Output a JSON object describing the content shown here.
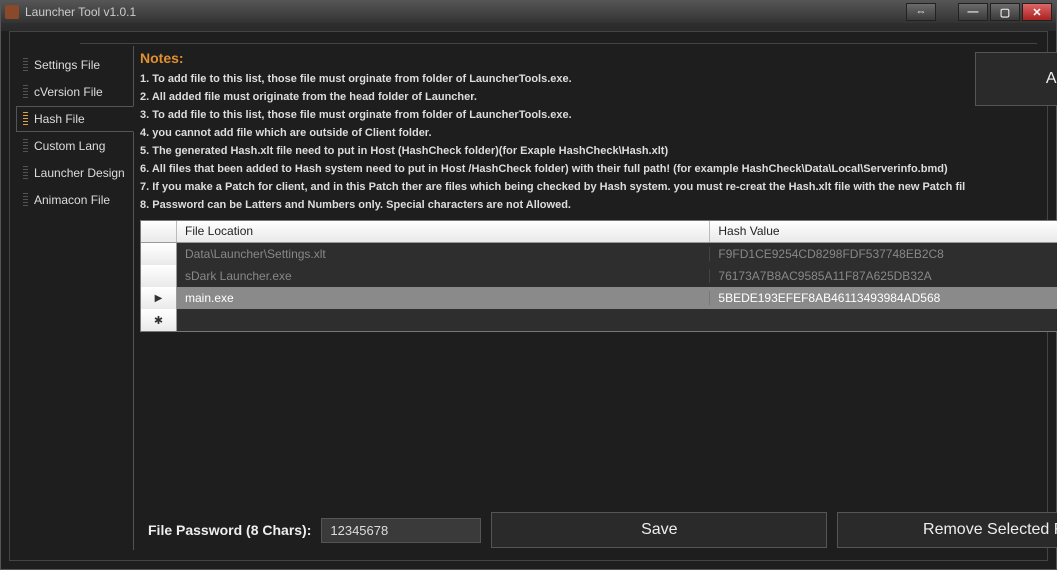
{
  "window": {
    "title": "Launcher Tool v1.0.1"
  },
  "sidebar": {
    "tabs": [
      {
        "label": "Settings File"
      },
      {
        "label": "cVersion File"
      },
      {
        "label": "Hash File"
      },
      {
        "label": "Custom Lang"
      },
      {
        "label": "Launcher Design"
      },
      {
        "label": "Animacon File"
      }
    ],
    "active_index": 2
  },
  "notes": {
    "title": "Notes:",
    "lines": [
      "1. To add file to this list, those file must orginate from folder of LauncherTools.exe.",
      "2. All added file must originate from the head folder of Launcher.",
      "3. To add file to this list, those file must orginate from folder of LauncherTools.exe.",
      "4. you cannot add file which are outside of Client folder.",
      "5. The generated Hash.xlt file need to put in Host (HashCheck folder)(for Exaple HashCheck\\Hash.xlt)",
      "6. All files that been added to Hash system need to put in Host /HashCheck folder) with their full path! (for example HashCheck\\Data\\Local\\Serverinfo.bmd)",
      "7. If you make a Patch for client, and in this Patch ther are files which being checked by Hash system. you must re-creat the Hash.xlt file with the new Patch fil",
      "8. Password can be Latters and Numbers only. Special characters are not Allowed."
    ]
  },
  "buttons": {
    "add_file": "Add File",
    "save": "Save",
    "remove": "Remove Selected Files"
  },
  "grid": {
    "headers": {
      "location": "File Location",
      "hash": "Hash Value"
    },
    "rows": [
      {
        "location": "Data\\Launcher\\Settings.xlt",
        "hash": "F9FD1CE9254CD8298FDF537748EB2C8"
      },
      {
        "location": "sDark Launcher.exe",
        "hash": "76173A7B8AC9585A11F87A625DB32A"
      },
      {
        "location": "main.exe",
        "hash": "5BEDE193EFEF8AB46113493984AD568"
      }
    ],
    "selected_index": 2
  },
  "password": {
    "label": "File Password (8 Chars):",
    "value": "12345678"
  }
}
